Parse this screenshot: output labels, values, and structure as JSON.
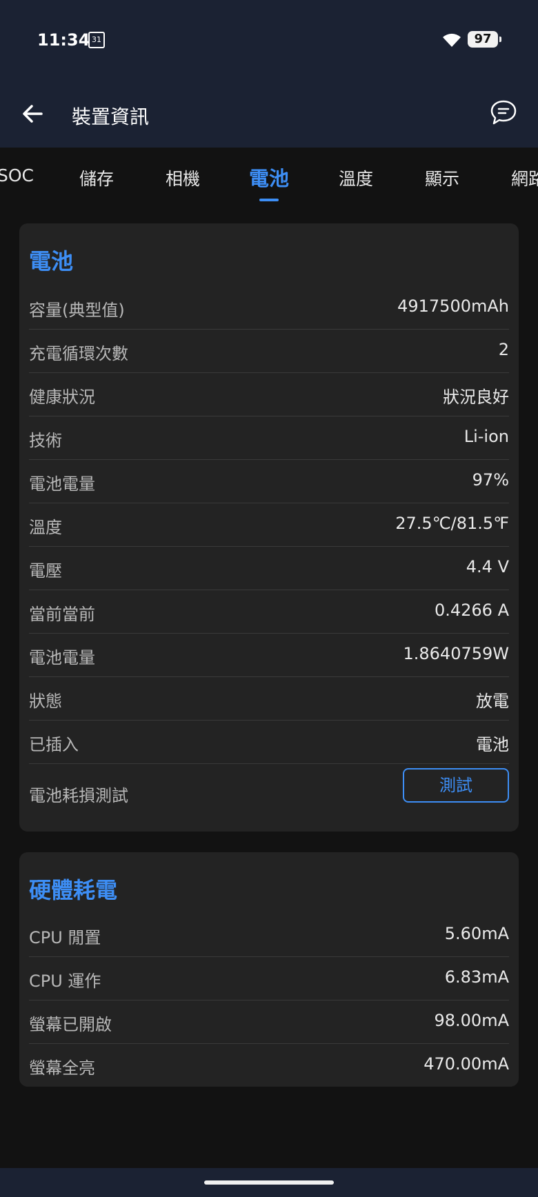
{
  "status_bar": {
    "time": "11:34",
    "calendar_day": "31",
    "battery": "97"
  },
  "app_bar": {
    "title": "裝置資訊"
  },
  "tabs": [
    "SOC",
    "儲存",
    "相機",
    "電池",
    "溫度",
    "顯示",
    "網路"
  ],
  "active_tab_index": 3,
  "battery_card": {
    "title": "電池",
    "rows": [
      {
        "label": "容量(典型值)",
        "value": "4917500mAh"
      },
      {
        "label": "充電循環次數",
        "value": "2"
      },
      {
        "label": "健康狀況",
        "value": "狀況良好"
      },
      {
        "label": "技術",
        "value": "Li-ion"
      },
      {
        "label": "電池電量",
        "value": "97%"
      },
      {
        "label": "溫度",
        "value": "27.5℃/81.5℉"
      },
      {
        "label": "電壓",
        "value": "4.4 V"
      },
      {
        "label": "當前當前",
        "value": "0.4266 A"
      },
      {
        "label": "電池電量",
        "value": "1.8640759W"
      },
      {
        "label": "狀態",
        "value": "放電"
      },
      {
        "label": "已插入",
        "value": "電池"
      }
    ],
    "wear_test_label": "電池耗損測試",
    "test_button_label": "測試"
  },
  "hardware_card": {
    "title": "硬體耗電",
    "rows": [
      {
        "label": "CPU 閒置",
        "value": "5.60mA"
      },
      {
        "label": "CPU 運作",
        "value": "6.83mA"
      },
      {
        "label": "螢幕已開啟",
        "value": "98.00mA"
      },
      {
        "label": "螢幕全亮",
        "value": "470.00mA"
      }
    ]
  },
  "colors": {
    "accent": "#3d8ef5",
    "header_bg": "#1b2233",
    "card_bg": "#232323",
    "page_bg": "#121212"
  }
}
